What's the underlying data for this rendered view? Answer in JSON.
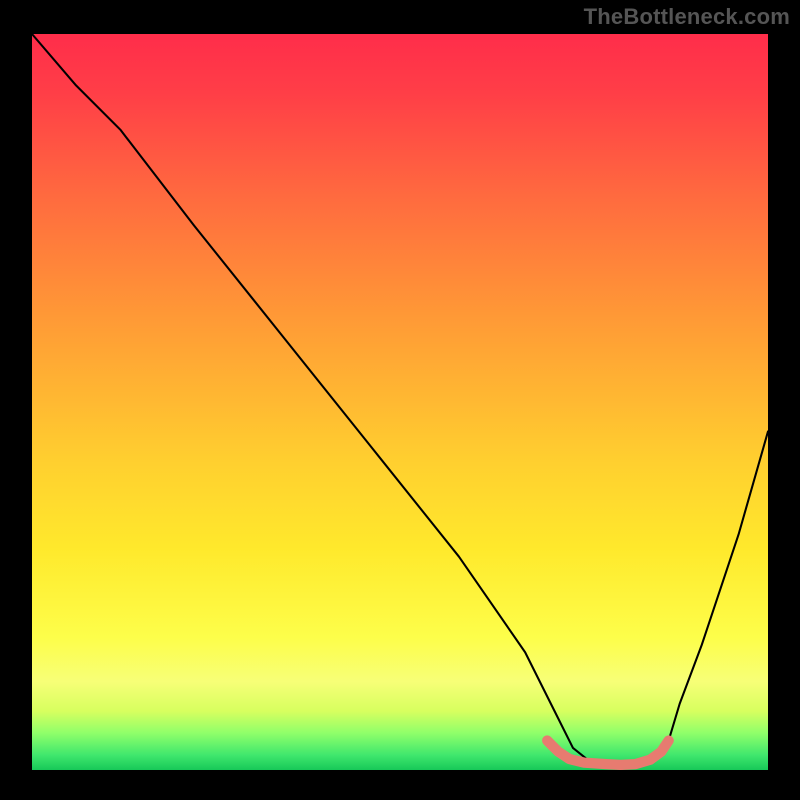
{
  "watermark": "TheBottleneck.com",
  "chart_data": {
    "type": "line",
    "title": "",
    "xlabel": "",
    "ylabel": "",
    "xlim": [
      0,
      100
    ],
    "ylim": [
      0,
      100
    ],
    "grid": false,
    "legend": false,
    "background": "red-yellow-green vertical gradient",
    "series": [
      {
        "name": "black-curve",
        "color": "#000000",
        "x": [
          0,
          6,
          12,
          22,
          34,
          46,
          58,
          67,
          71,
          73.5,
          76,
          80,
          84,
          86.5,
          88,
          91,
          96,
          100
        ],
        "values": [
          100,
          93,
          87,
          74,
          59,
          44,
          29,
          16,
          8,
          3,
          1,
          0.5,
          1,
          4,
          9,
          17,
          32,
          46
        ]
      },
      {
        "name": "salmon-floor-segment",
        "color": "#e77b70",
        "bold": true,
        "x": [
          70,
          71.5,
          73,
          75,
          78,
          80,
          82,
          84,
          85.5,
          86.5
        ],
        "values": [
          4,
          2.5,
          1.5,
          1,
          0.8,
          0.7,
          0.8,
          1.4,
          2.5,
          4
        ]
      }
    ]
  }
}
